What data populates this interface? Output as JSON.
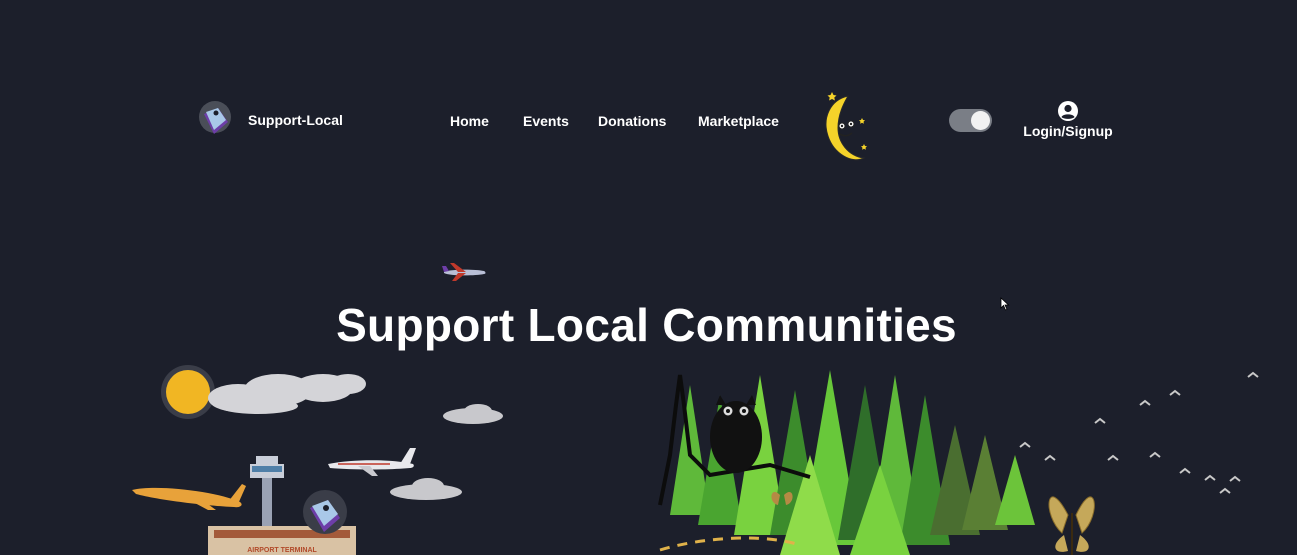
{
  "brand": {
    "name": "Support-Local",
    "logo_icon": "location-tag-icon"
  },
  "nav": {
    "items": [
      {
        "label": "Home"
      },
      {
        "label": "Events"
      },
      {
        "label": "Donations"
      },
      {
        "label": "Marketplace"
      }
    ]
  },
  "theme": {
    "mascot_icon": "crescent-moon-icon",
    "toggle_state": "dark"
  },
  "account": {
    "label": "Login/Signup",
    "icon": "user-circle-icon"
  },
  "hero": {
    "title": "Support Local Communities",
    "terminal_sign": "AIRPORT TERMINAL"
  },
  "colors": {
    "background": "#1c1f2b",
    "moon": "#f5d32a",
    "sun": "#f1b623",
    "tree_light": "#6cc43a",
    "tree_dark": "#2f6e2a",
    "logo_purple": "#6d3ea8",
    "logo_blue": "#a9c8e8"
  }
}
